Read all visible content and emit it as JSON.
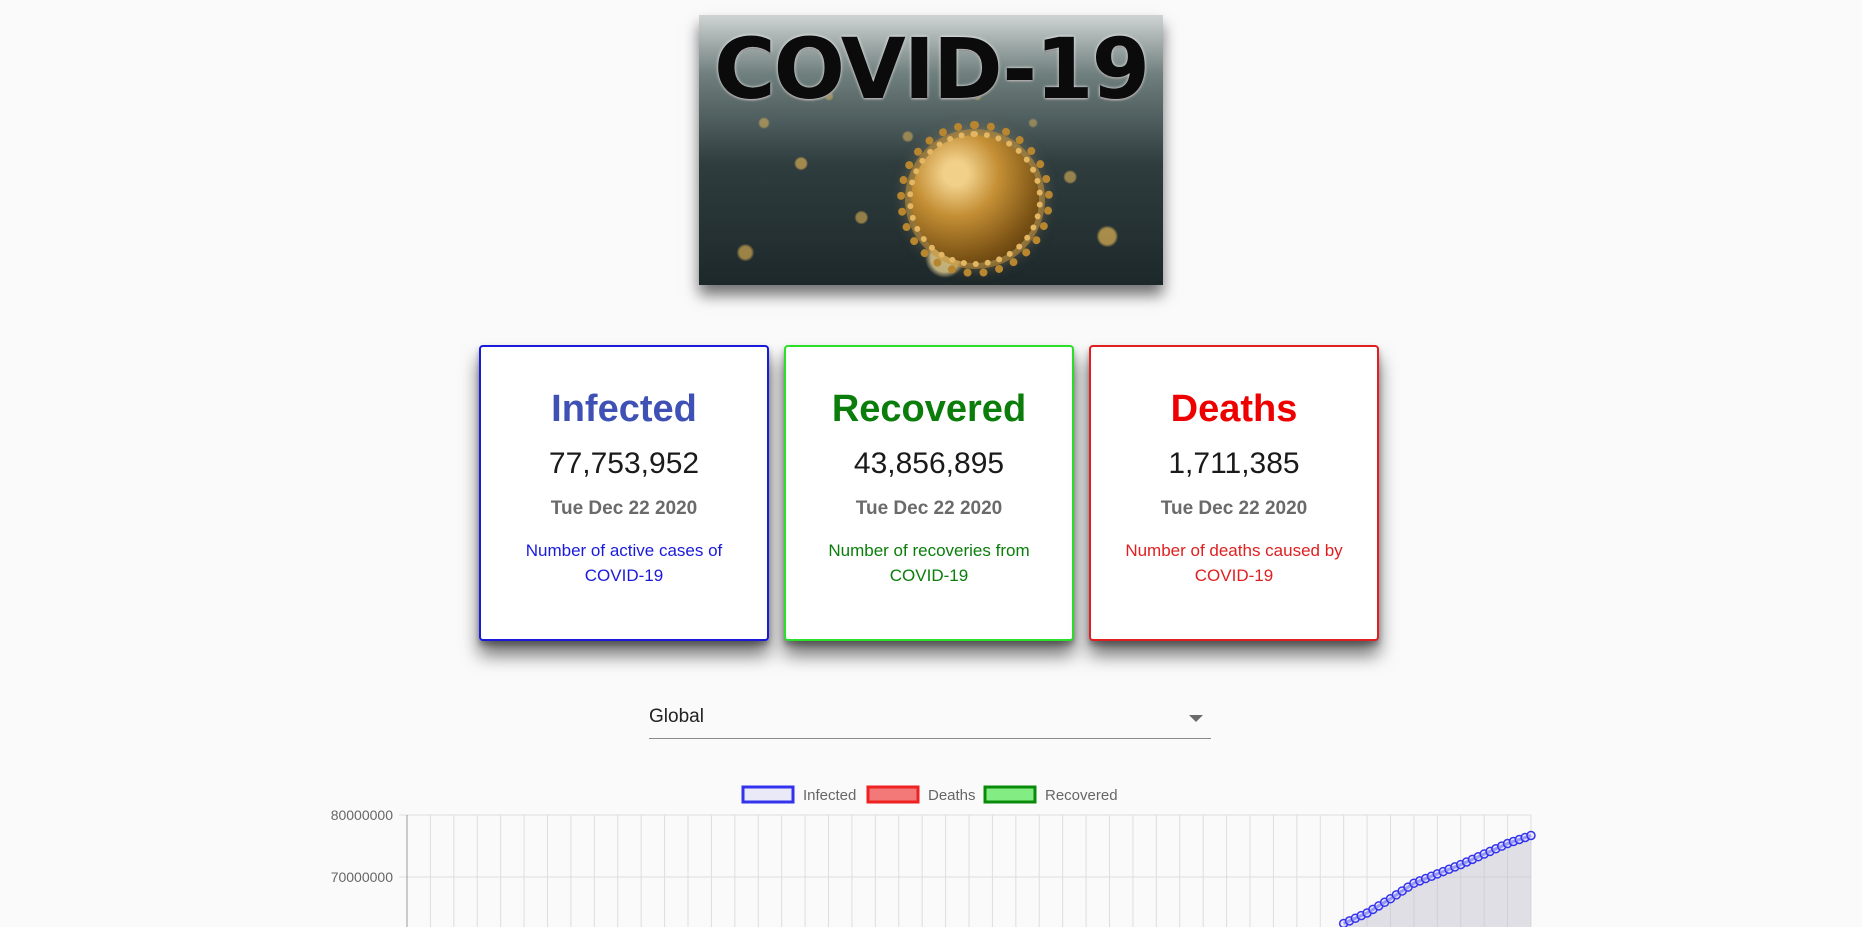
{
  "banner": {
    "title": "COVID-19"
  },
  "cards": {
    "infected": {
      "title": "Infected",
      "value": "77,753,952",
      "date": "Tue Dec 22 2020",
      "description": "Number of active cases of COVID-19",
      "color": "#3f51b5",
      "border_color": "#1a1adb",
      "text_color": "#1a1adb"
    },
    "recovered": {
      "title": "Recovered",
      "value": "43,856,895",
      "date": "Tue Dec 22 2020",
      "description": "Number of recoveries from COVID-19",
      "color": "#0a7d0a",
      "border_color": "#2be02b",
      "text_color": "#0a7d0a"
    },
    "deaths": {
      "title": "Deaths",
      "value": "1,711,385",
      "date": "Tue Dec 22 2020",
      "description": "Number of deaths caused by COVID-19",
      "color": "#ee0000",
      "border_color": "#e02020",
      "text_color": "#e02020"
    }
  },
  "country_select": {
    "value": "Global",
    "icon": "chevron-down-icon"
  },
  "chart_data": {
    "type": "line",
    "legend": [
      "Infected",
      "Deaths",
      "Recovered"
    ],
    "legend_position": "top-center",
    "grid": true,
    "yticks": [
      "80000000",
      "70000000"
    ],
    "ylim_visible": [
      62000000,
      80000000
    ],
    "x_count": 48,
    "series": [
      {
        "name": "Infected",
        "color": "#3333ee",
        "fill": "rgba(200,200,240,0.35)",
        "visible_tail": [
          {
            "i": 40,
            "y": 62500000
          },
          {
            "i": 41,
            "y": 64200000
          },
          {
            "i": 42,
            "y": 66500000
          },
          {
            "i": 43,
            "y": 69000000
          },
          {
            "i": 44,
            "y": 70500000
          },
          {
            "i": 45,
            "y": 72000000
          },
          {
            "i": 46,
            "y": 73700000
          },
          {
            "i": 47,
            "y": 75400000
          },
          {
            "i": 48,
            "y": 76700000
          }
        ]
      },
      {
        "name": "Deaths",
        "color": "#ee2222",
        "fill": "rgba(238,34,34,0.6)",
        "visible_tail": []
      },
      {
        "name": "Recovered",
        "color": "#0a8a0a",
        "fill": "rgba(80,230,80,0.7)",
        "visible_tail": []
      }
    ]
  }
}
